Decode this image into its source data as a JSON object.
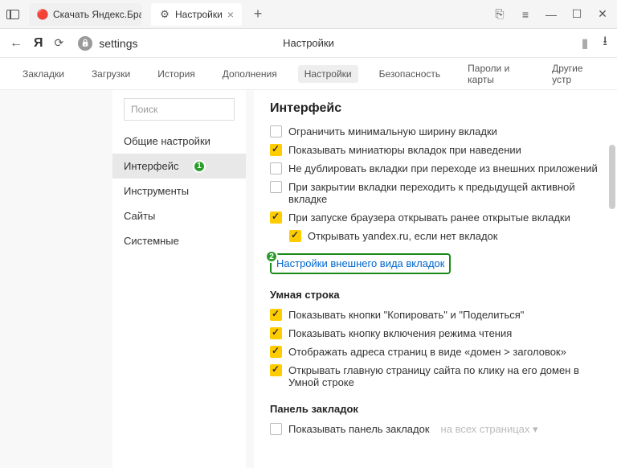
{
  "titlebar": {
    "tabs": [
      {
        "title": "Скачать Яндекс.Браузер д"
      },
      {
        "title": "Настройки"
      }
    ]
  },
  "addressbar": {
    "url": "settings",
    "page_title": "Настройки"
  },
  "subnav": {
    "items": [
      "Закладки",
      "Загрузки",
      "История",
      "Дополнения",
      "Настройки",
      "Безопасность",
      "Пароли и карты",
      "Другие устр"
    ],
    "active_index": 4
  },
  "sidebar": {
    "search_placeholder": "Поиск",
    "items": [
      "Общие настройки",
      "Интерфейс",
      "Инструменты",
      "Сайты",
      "Системные"
    ],
    "active_index": 1
  },
  "main": {
    "section_title": "Интерфейс",
    "options": [
      {
        "checked": false,
        "label": "Ограничить минимальную ширину вкладки",
        "indent": false
      },
      {
        "checked": true,
        "label": "Показывать миниатюры вкладок при наведении",
        "indent": false
      },
      {
        "checked": false,
        "label": "Не дублировать вкладки при переходе из внешних приложений",
        "indent": false
      },
      {
        "checked": false,
        "label": "При закрытии вкладки переходить к предыдущей активной вкладке",
        "indent": false
      },
      {
        "checked": true,
        "label": "При запуске браузера открывать ранее открытые вкладки",
        "indent": false
      },
      {
        "checked": true,
        "label": "Открывать yandex.ru, если нет вкладок",
        "indent": true
      }
    ],
    "link": "Настройки внешнего вида вкладок",
    "smart_title": "Умная строка",
    "smart_options": [
      {
        "checked": true,
        "label": "Показывать кнопки \"Копировать\" и \"Поделиться\""
      },
      {
        "checked": true,
        "label": "Показывать кнопку включения режима чтения"
      },
      {
        "checked": true,
        "label": "Отображать адреса страниц в виде «домен > заголовок»"
      },
      {
        "checked": true,
        "label": "Открывать главную страницу сайта по клику на его домен в Умной строке"
      }
    ],
    "bookmarks_title": "Панель закладок",
    "bookmarks_opt": {
      "checked": false,
      "label": "Показывать панель закладок",
      "disabled_suffix": "на всех страницах ▾"
    }
  },
  "badges": {
    "b1": "1",
    "b2": "2"
  }
}
